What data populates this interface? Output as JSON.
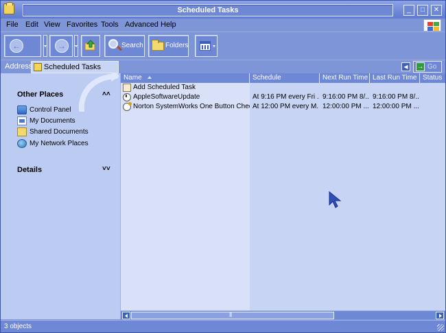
{
  "window": {
    "title": "Scheduled Tasks"
  },
  "titlebar_buttons": {
    "minimize": "_",
    "maximize": "□",
    "close": "✕"
  },
  "menu": [
    "File",
    "Edit",
    "View",
    "Favorites",
    "Tools",
    "Advanced",
    "Help"
  ],
  "toolbar": {
    "back_icon": "back-arrow-icon",
    "forward_icon": "forward-arrow-icon",
    "search_label": "Search",
    "folders_label": "Folders"
  },
  "address": {
    "label": "Address",
    "value": "Scheduled Tasks",
    "go_label": "Go"
  },
  "sidebar": {
    "other_places": {
      "title": "Other Places",
      "items": [
        {
          "label": "Control Panel",
          "icon": "control-panel-icon"
        },
        {
          "label": "My Documents",
          "icon": "my-documents-icon"
        },
        {
          "label": "Shared Documents",
          "icon": "shared-documents-icon"
        },
        {
          "label": "My Network Places",
          "icon": "network-places-icon"
        }
      ]
    },
    "details": {
      "title": "Details"
    }
  },
  "list": {
    "columns": [
      "Name",
      "Schedule",
      "Next Run Time",
      "Last Run Time",
      "Status"
    ],
    "rows": [
      {
        "name": "Add Scheduled Task",
        "schedule": "",
        "next_run": "",
        "last_run": "",
        "status": ""
      },
      {
        "name": "AppleSoftwareUpdate",
        "schedule": "At 9:16 PM every Fri ...",
        "next_run": "9:16:00 PM  8/...",
        "last_run": "9:16:00 PM  8/...",
        "status": ""
      },
      {
        "name": "Norton SystemWorks One Button Checkup",
        "schedule": "At 12:00 PM every M...",
        "next_run": "12:00:00 PM ...",
        "last_run": "12:00:00 PM ...",
        "status": ""
      }
    ]
  },
  "statusbar": {
    "text": "3 objects"
  },
  "colors": {
    "accent": "#6f88d6",
    "pane": "#bccbf2",
    "list_bg": "#d8e1f8"
  }
}
